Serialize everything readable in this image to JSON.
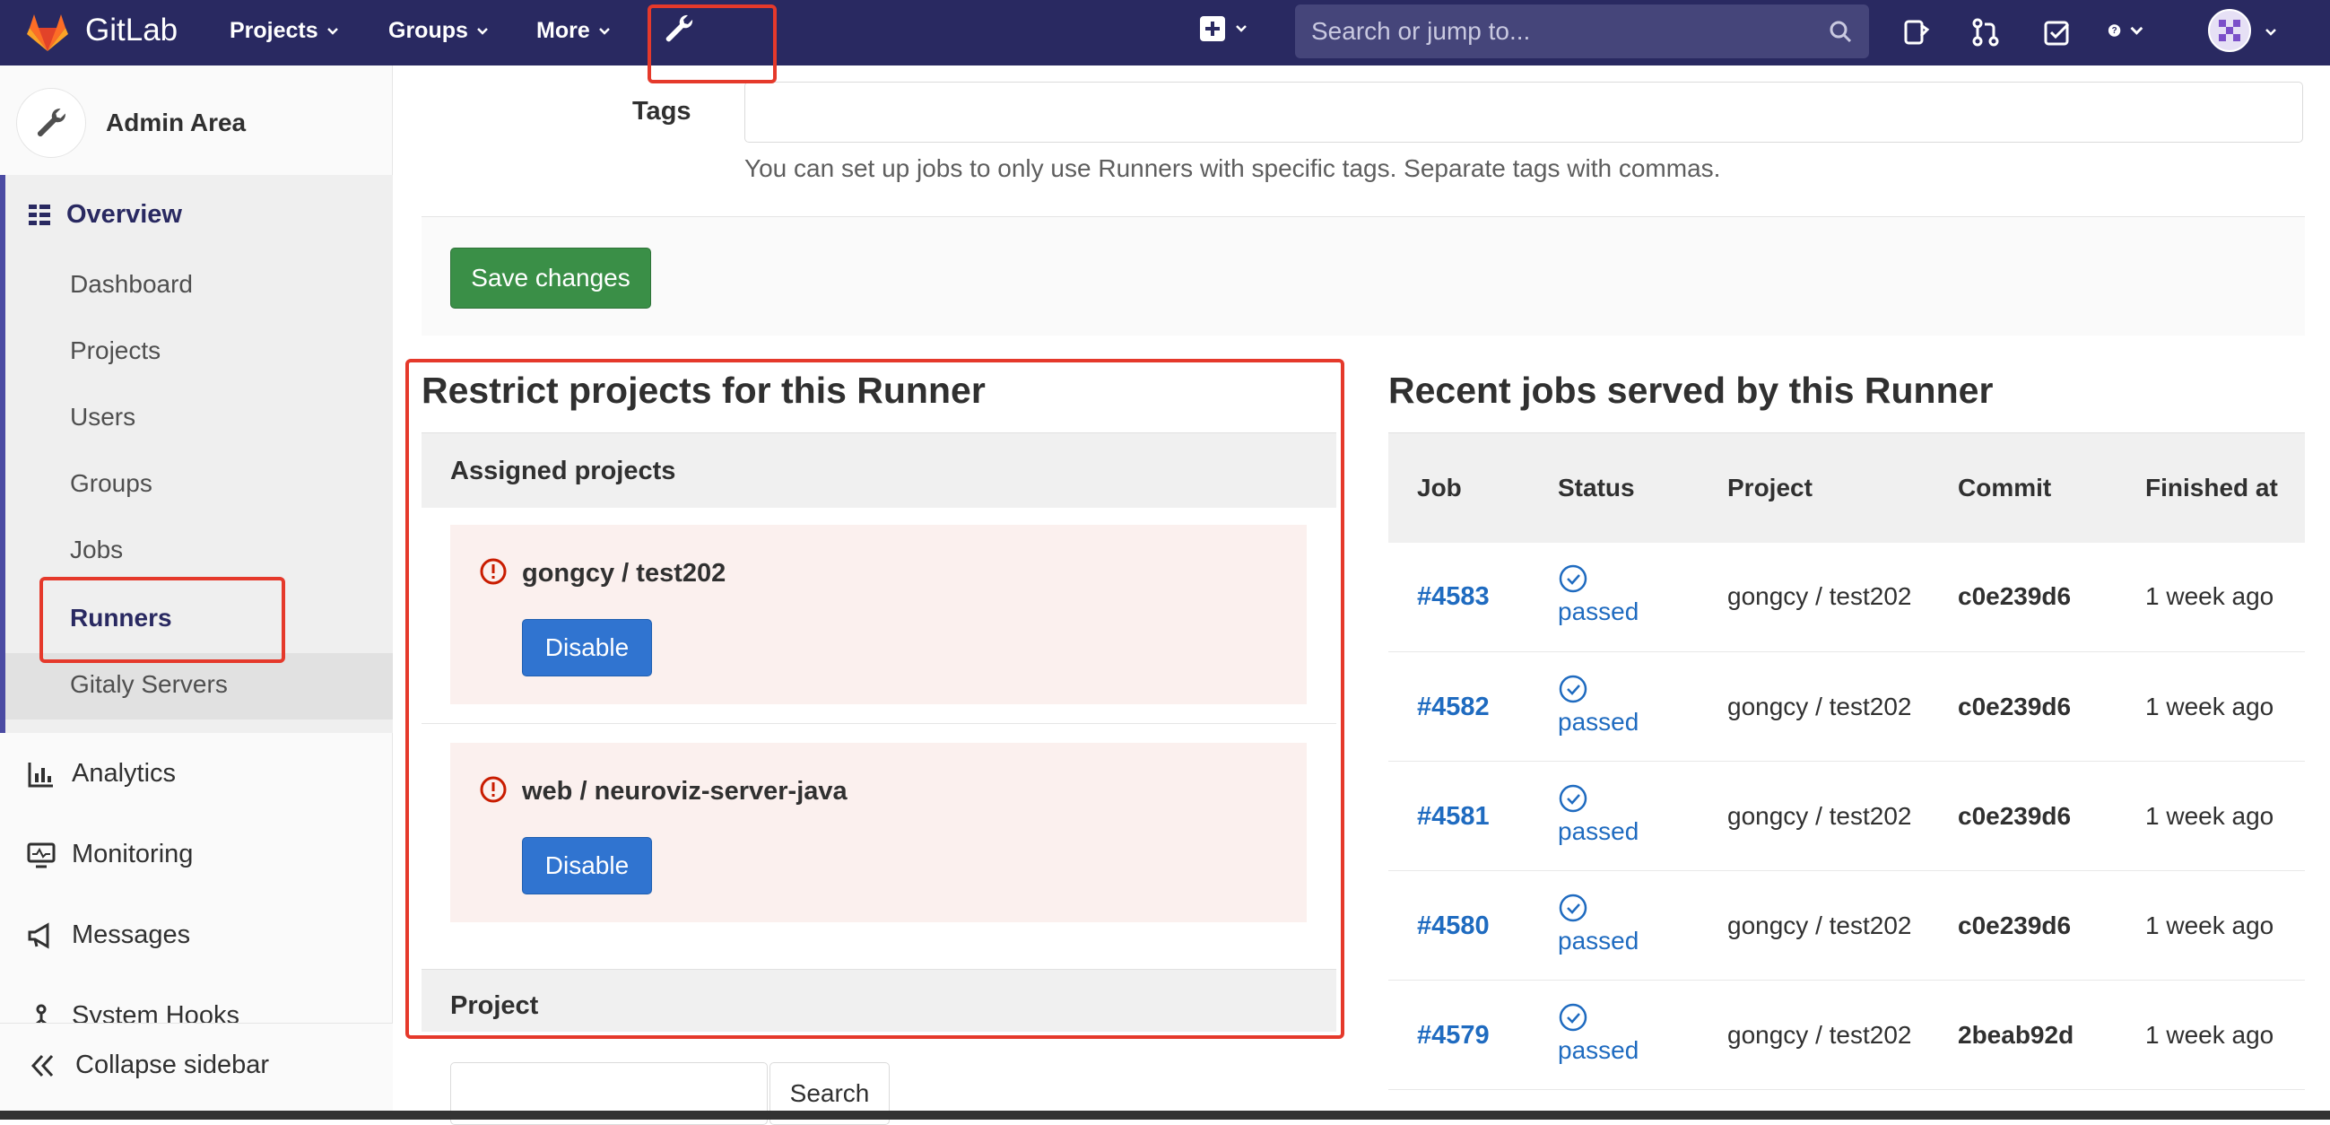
{
  "navbar": {
    "brand": "GitLab",
    "menus": [
      "Projects",
      "Groups",
      "More"
    ],
    "search_placeholder": "Search or jump to...",
    "colors": {
      "background": "#292961",
      "logo": "#fc6d26"
    }
  },
  "sidebar": {
    "title": "Admin Area",
    "section": "Overview",
    "sub_items": [
      "Dashboard",
      "Projects",
      "Users",
      "Groups",
      "Jobs",
      "Runners",
      "Gitaly Servers"
    ],
    "active_item": "Runners",
    "items": [
      "Analytics",
      "Monitoring",
      "Messages",
      "System Hooks"
    ],
    "collapse_label": "Collapse sidebar"
  },
  "form": {
    "tags_label": "Tags",
    "tags_value": "",
    "tags_help": "You can set up jobs to only use Runners with specific tags. Separate tags with commas.",
    "save_label": "Save changes"
  },
  "restrict": {
    "title": "Restrict projects for this Runner",
    "assigned_header": "Assigned projects",
    "projects": [
      {
        "name": "gongcy / test202",
        "button": "Disable"
      },
      {
        "name": "web / neuroviz-server-java",
        "button": "Disable"
      }
    ],
    "project_header": "Project",
    "search_button": "Search"
  },
  "jobs": {
    "title": "Recent jobs served by this Runner",
    "columns": [
      "Job",
      "Status",
      "Project",
      "Commit",
      "Finished at"
    ],
    "rows": [
      {
        "job": "#4583",
        "status": "passed",
        "project": "gongcy / test202",
        "commit": "c0e239d6",
        "finished": "1 week ago"
      },
      {
        "job": "#4582",
        "status": "passed",
        "project": "gongcy / test202",
        "commit": "c0e239d6",
        "finished": "1 week ago"
      },
      {
        "job": "#4581",
        "status": "passed",
        "project": "gongcy / test202",
        "commit": "c0e239d6",
        "finished": "1 week ago"
      },
      {
        "job": "#4580",
        "status": "passed",
        "project": "gongcy / test202",
        "commit": "c0e239d6",
        "finished": "1 week ago"
      },
      {
        "job": "#4579",
        "status": "passed",
        "project": "gongcy / test202",
        "commit": "2beab92d",
        "finished": "1 week ago"
      }
    ]
  },
  "annotation_color": "#e5392b"
}
